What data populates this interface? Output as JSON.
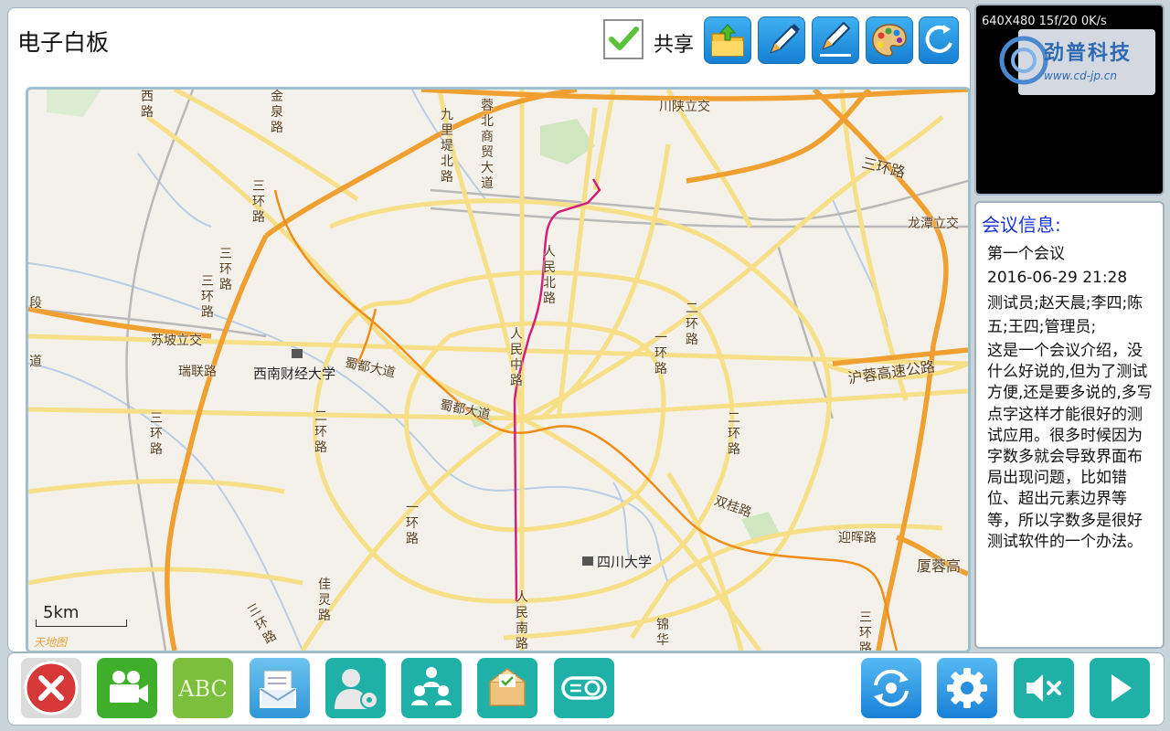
{
  "board": {
    "title": "电子白板",
    "share_label": "共享",
    "share_checked": true
  },
  "toolbar": {
    "icons": [
      "folder-upload-icon",
      "pen-icon",
      "pen-line-icon",
      "palette-icon",
      "eraser-refresh-icon"
    ]
  },
  "map": {
    "scale_label": "5km",
    "logo_text": "天地图",
    "pois": [
      "西南财经大学",
      "四川大学"
    ],
    "labels": {
      "chuanshan": "川陕立交",
      "longtan": "龙潭立交",
      "sucheng": "苏坡立交",
      "huronggao": "沪蓉高速公路",
      "xiarong": "厦蓉高",
      "ruilian": "瑞联路",
      "shudu1": "蜀都大道",
      "shudu2": "蜀都大道",
      "shuanggui": "双桂路",
      "yinghui": "迎晖路",
      "sanhuan_ne": "三环路",
      "v_xilu": "西路",
      "v_jinquan": "金泉路",
      "v_sanhuan_nw": "三环路",
      "v_sanhuan_w": "三环路",
      "v_sanhuan_w2": "三环路",
      "v_sanhuan_sw": "三环路",
      "v_jiuli": "九里堤北路",
      "v_rongbei": "蓉北商贸大道",
      "v_renminbei": "人民北路",
      "v_renminzhong": "人民中路",
      "v_renminnan": "人民南路",
      "v_erhuan_e": "二环路",
      "v_erhuan_e2": "二环路",
      "v_erhuan_w": "二环路",
      "v_yihuan_e": "一环路",
      "v_yihuan_sw": "一环路",
      "v_jiajing": "佳灵路",
      "v_jinhua": "锦华",
      "v_sanhuan_se": "三环路",
      "v_sanhuan_s": "三环路",
      "v_duan": "段",
      "v_dao": "道"
    }
  },
  "video": {
    "stats": "640X480 15f/20 0K/s",
    "brand_name": "劲普科技",
    "brand_url": "www.cd-jp.cn"
  },
  "meeting": {
    "title": "会议信息:",
    "name": "第一个会议",
    "datetime": "2016-06-29 21:28",
    "participants": "测试员;赵天晨;李四;陈五;王四;管理员;",
    "description": "这是一个会议介绍，没什么好说的,但为了测试方便,还是要多说的,多写点字这样才能很好的测试应用。很多时候因为字数多就会导致界面布局出现问题，比如错位、超出元素边界等等，所以字数多是很好测试软件的一个办法。"
  },
  "bottombar": {
    "buttons": [
      "close-icon",
      "video-camera-icon",
      "abc-text-icon",
      "message-icon",
      "user-settings-icon",
      "users-icon",
      "mail-check-icon",
      "projector-icon",
      "camera-switch-icon",
      "settings-icon",
      "mute-icon",
      "play-icon"
    ]
  },
  "colors": {
    "accent_blue": "#1a80d6",
    "red": "#d63838",
    "green": "#3fae2a",
    "teal": "#1fb0a8",
    "magenta_route": "#d1207a",
    "orange_road": "#f0a030",
    "yellow_road": "#f6df86"
  }
}
